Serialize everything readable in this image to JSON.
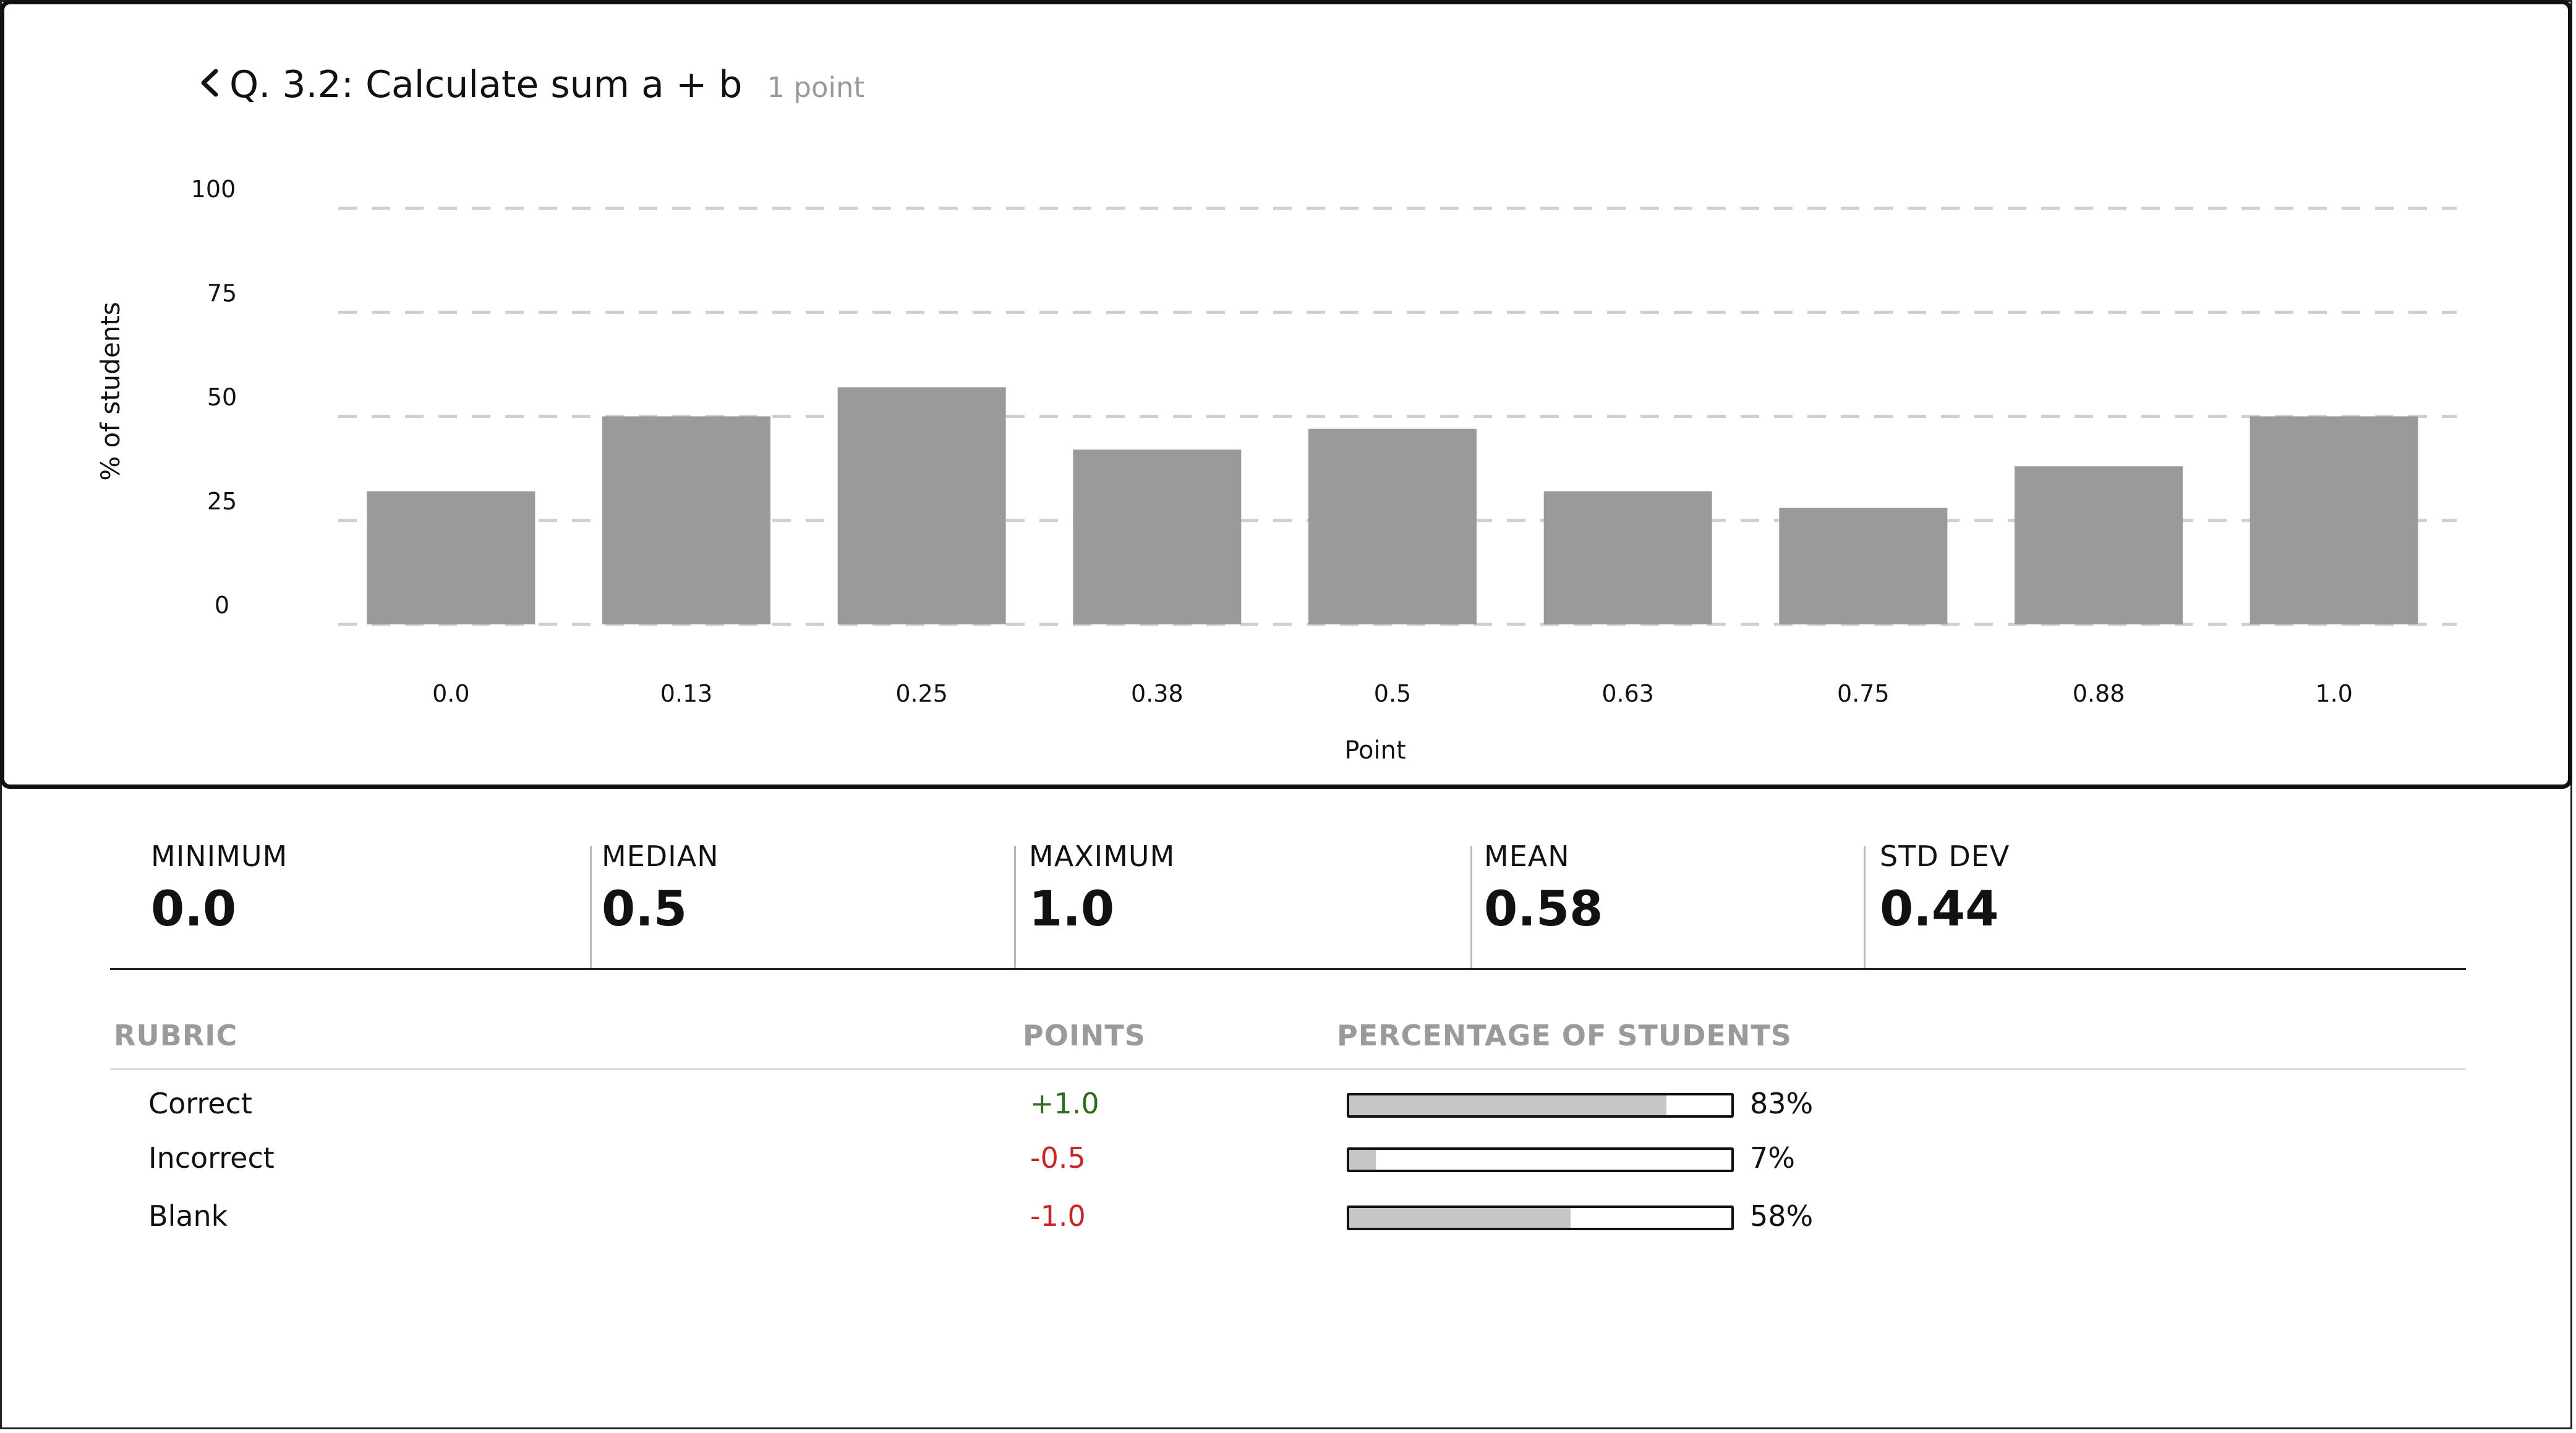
{
  "header": {
    "title": "Q. 3.2: Calculate sum a + b",
    "points": "1 point",
    "back_icon": "chevron-left-icon"
  },
  "chart_data": {
    "type": "bar",
    "categories": [
      "0.0",
      "0.13",
      "0.25",
      "0.38",
      "0.5",
      "0.63",
      "0.75",
      "0.88",
      "1.0"
    ],
    "values": [
      32,
      50,
      57,
      42,
      47,
      32,
      28,
      38,
      50
    ],
    "ylim": [
      0,
      100
    ],
    "yticks": [
      0,
      25,
      50,
      75,
      100
    ],
    "xlabel": "Point",
    "ylabel": "% of students",
    "grid": true,
    "bar_color": "#9a9a9a"
  },
  "stats": [
    {
      "label": "MINIMUM",
      "value": "0.0"
    },
    {
      "label": "MEDIAN",
      "value": "0.5"
    },
    {
      "label": "MAXIMUM",
      "value": "1.0"
    },
    {
      "label": "MEAN",
      "value": "0.58"
    },
    {
      "label": "STD DEV",
      "value": "0.44"
    }
  ],
  "rubric": {
    "headers": {
      "rubric": "RUBRIC",
      "points": "POINTS",
      "percentage": "PERCENTAGE OF STUDENTS"
    },
    "rows": [
      {
        "name": "Correct",
        "points": "+1.0",
        "percent_text": "83%",
        "percent": 0.83
      },
      {
        "name": "Incorrect",
        "points": "-0.5",
        "percent_text": "7%",
        "percent": 0.07
      },
      {
        "name": "Blank",
        "points": "-1.0",
        "percent_text": "58%",
        "percent": 0.58
      }
    ]
  },
  "colors": {
    "positive": "#2e6b1f",
    "negative": "#c62828",
    "bar": "#9a9a9a"
  }
}
